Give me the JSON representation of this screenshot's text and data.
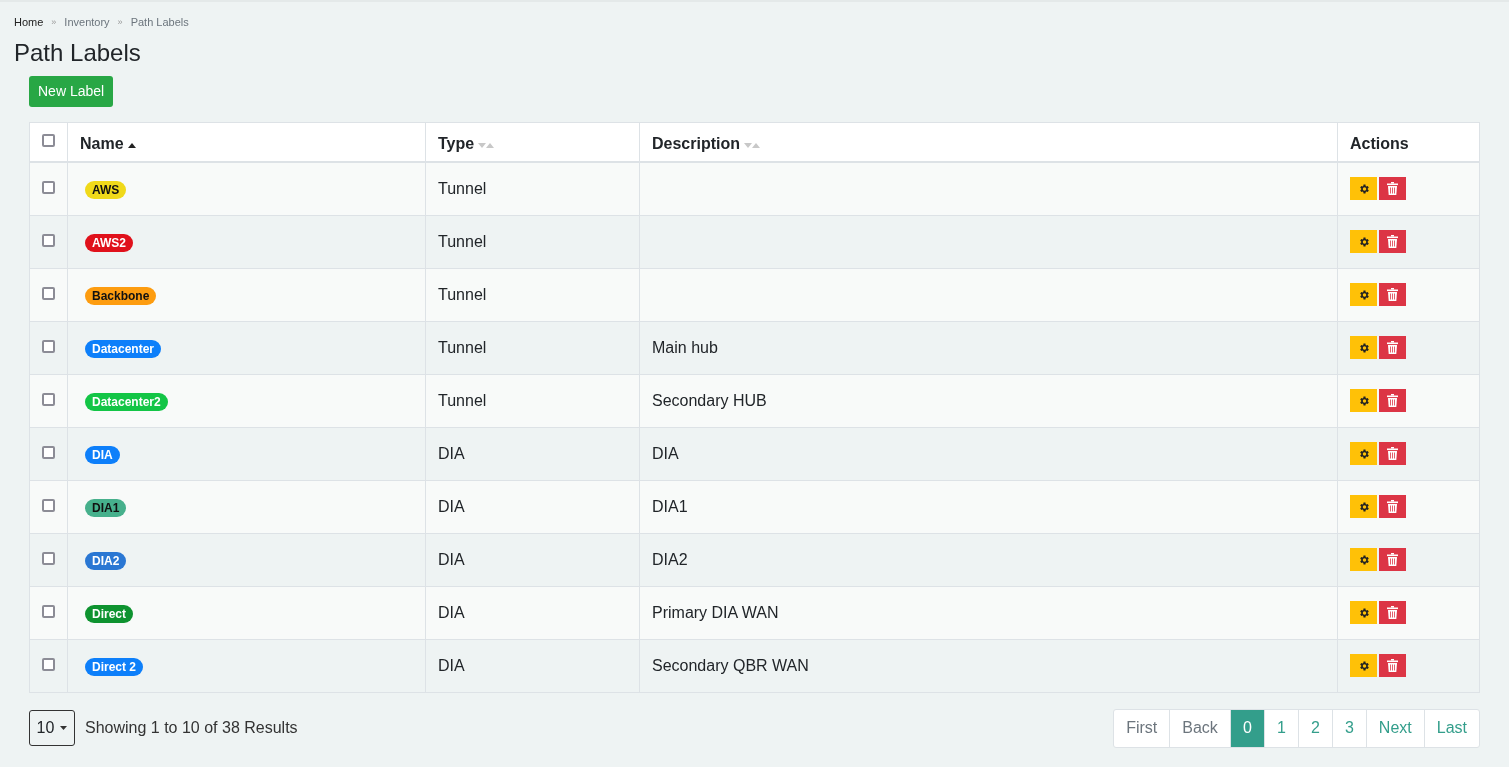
{
  "breadcrumb": [
    {
      "label": "Home",
      "kind": "link"
    },
    {
      "label": "»",
      "kind": "separator"
    },
    {
      "label": "Inventory",
      "kind": "muted"
    },
    {
      "label": "»",
      "kind": "separator"
    },
    {
      "label": "Path Labels",
      "kind": "muted"
    }
  ],
  "title": "Path Labels",
  "new_button": "New Label",
  "table": {
    "select_all": {
      "checked": false
    },
    "columns": [
      {
        "label": "Name",
        "kind": "sortable",
        "sorted": true
      },
      {
        "label": "Type",
        "kind": "sortable",
        "sorted": false
      },
      {
        "label": "Description",
        "kind": "sortable",
        "sorted": false
      },
      {
        "label": "Actions",
        "kind": "plain"
      }
    ],
    "rows": [
      {
        "checked": false,
        "name": "AWS",
        "color": "#f0d91a",
        "type": "Tunnel",
        "description": ""
      },
      {
        "checked": false,
        "name": "AWS2",
        "color": "#e0111b",
        "type": "Tunnel",
        "description": ""
      },
      {
        "checked": false,
        "name": "Backbone",
        "color": "#fd9c10",
        "type": "Tunnel",
        "description": ""
      },
      {
        "checked": false,
        "name": "Datacenter",
        "color": "#0d7ffa",
        "type": "Tunnel",
        "description": "Main hub"
      },
      {
        "checked": false,
        "name": "Datacenter2",
        "color": "#13c546",
        "type": "Tunnel",
        "description": "Secondary HUB"
      },
      {
        "checked": false,
        "name": "DIA",
        "color": "#0d7ffa",
        "type": "DIA",
        "description": "DIA"
      },
      {
        "checked": false,
        "name": "DIA1",
        "color": "#46b08c",
        "type": "DIA",
        "description": "DIA1"
      },
      {
        "checked": false,
        "name": "DIA2",
        "color": "#2a77d3",
        "type": "DIA",
        "description": "DIA2"
      },
      {
        "checked": false,
        "name": "Direct",
        "color": "#0e9330",
        "type": "DIA",
        "description": "Primary DIA WAN"
      },
      {
        "checked": false,
        "name": "Direct 2",
        "color": "#0d7ffa",
        "type": "DIA",
        "description": "Secondary QBR WAN"
      }
    ]
  },
  "page_size": "10",
  "summary": "Showing 1 to 10 of 38 Results",
  "pagination": [
    {
      "label": "First",
      "selected": false,
      "disabled": true
    },
    {
      "label": "Back",
      "selected": false,
      "disabled": true
    },
    {
      "label": "0",
      "selected": true,
      "disabled": false
    },
    {
      "label": "1",
      "selected": false,
      "disabled": false
    },
    {
      "label": "2",
      "selected": false,
      "disabled": false
    },
    {
      "label": "3",
      "selected": false,
      "disabled": false
    },
    {
      "label": "Next",
      "selected": false,
      "disabled": false
    },
    {
      "label": "Last",
      "selected": false,
      "disabled": false
    }
  ]
}
